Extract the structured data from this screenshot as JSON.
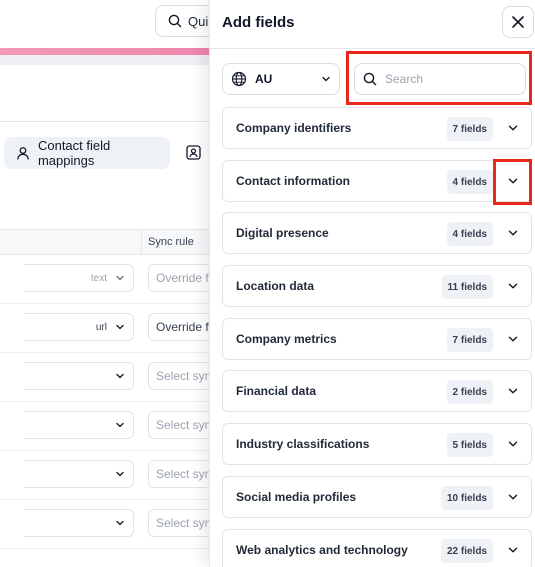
{
  "background": {
    "quick_label": "Qui",
    "active_tab_label": "Contact field mappings",
    "sync_header": "Sync rule",
    "rows": [
      {
        "type": "text",
        "sync": "Override fr",
        "type_dark": false,
        "sync_dark": false
      },
      {
        "type": "url",
        "sync": "Override fr",
        "type_dark": true,
        "sync_dark": true
      },
      {
        "type": "",
        "sync": "Select sync",
        "type_dark": false,
        "sync_dark": false
      },
      {
        "type": "",
        "sync": "Select sync",
        "type_dark": false,
        "sync_dark": false
      },
      {
        "type": "",
        "sync": "Select sync",
        "type_dark": false,
        "sync_dark": false
      },
      {
        "type": "",
        "sync": "Select sync",
        "type_dark": false,
        "sync_dark": false
      }
    ]
  },
  "panel": {
    "title": "Add fields",
    "country": "AU",
    "search": {
      "placeholder": "Search",
      "value": ""
    },
    "sections": [
      {
        "title": "Company identifiers",
        "count": "7 fields"
      },
      {
        "title": "Contact information",
        "count": "4 fields"
      },
      {
        "title": "Digital presence",
        "count": "4 fields"
      },
      {
        "title": "Location data",
        "count": "11 fields"
      },
      {
        "title": "Company metrics",
        "count": "7 fields"
      },
      {
        "title": "Financial data",
        "count": "2 fields"
      },
      {
        "title": "Industry classifications",
        "count": "5 fields"
      },
      {
        "title": "Social media profiles",
        "count": "10 fields"
      },
      {
        "title": "Web analytics and technology",
        "count": "22 fields"
      }
    ]
  },
  "colors": {
    "highlight": "#e8271d",
    "accent_gradient_start": "#f29ab8",
    "badge_bg": "#eef1f6"
  },
  "icons": {
    "close": "close-icon",
    "globe": "globe-icon",
    "search": "search-icon",
    "chevron": "chevron-down-icon",
    "person": "person-icon"
  }
}
